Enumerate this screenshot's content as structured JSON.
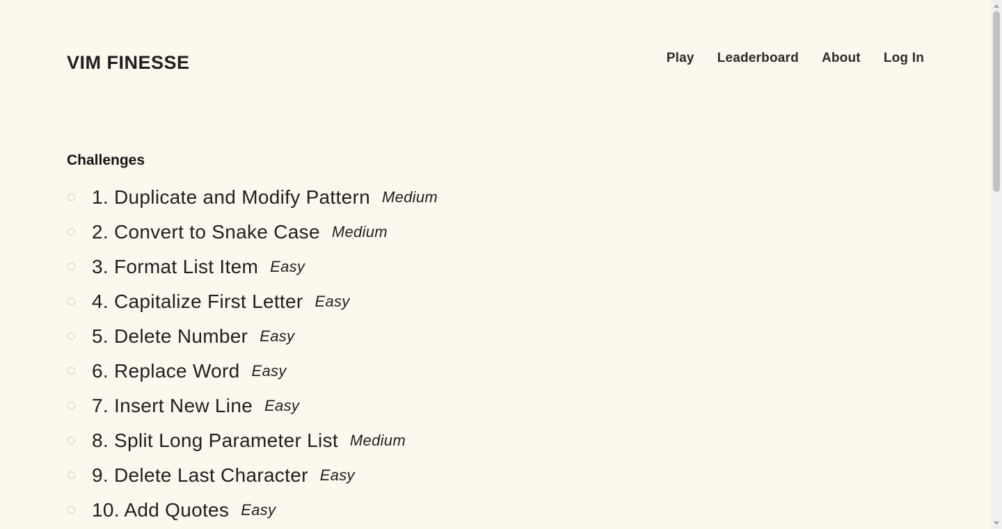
{
  "header": {
    "logo": "VIM FINESSE",
    "nav": [
      {
        "label": "Play"
      },
      {
        "label": "Leaderboard"
      },
      {
        "label": "About"
      },
      {
        "label": "Log In"
      }
    ]
  },
  "main": {
    "section_title": "Challenges",
    "challenges": [
      {
        "title": "1. Duplicate and Modify Pattern",
        "difficulty": "Medium"
      },
      {
        "title": "2. Convert to Snake Case",
        "difficulty": "Medium"
      },
      {
        "title": "3. Format List Item",
        "difficulty": "Easy"
      },
      {
        "title": "4. Capitalize First Letter",
        "difficulty": "Easy"
      },
      {
        "title": "5. Delete Number",
        "difficulty": "Easy"
      },
      {
        "title": "6. Replace Word",
        "difficulty": "Easy"
      },
      {
        "title": "7. Insert New Line",
        "difficulty": "Easy"
      },
      {
        "title": "8. Split Long Parameter List",
        "difficulty": "Medium"
      },
      {
        "title": "9. Delete Last Character",
        "difficulty": "Easy"
      },
      {
        "title": "10. Add Quotes",
        "difficulty": "Easy"
      }
    ]
  },
  "colors": {
    "background": "#fdf8ee",
    "text": "#1e1e1e",
    "bullet": "#d4d1ca"
  }
}
